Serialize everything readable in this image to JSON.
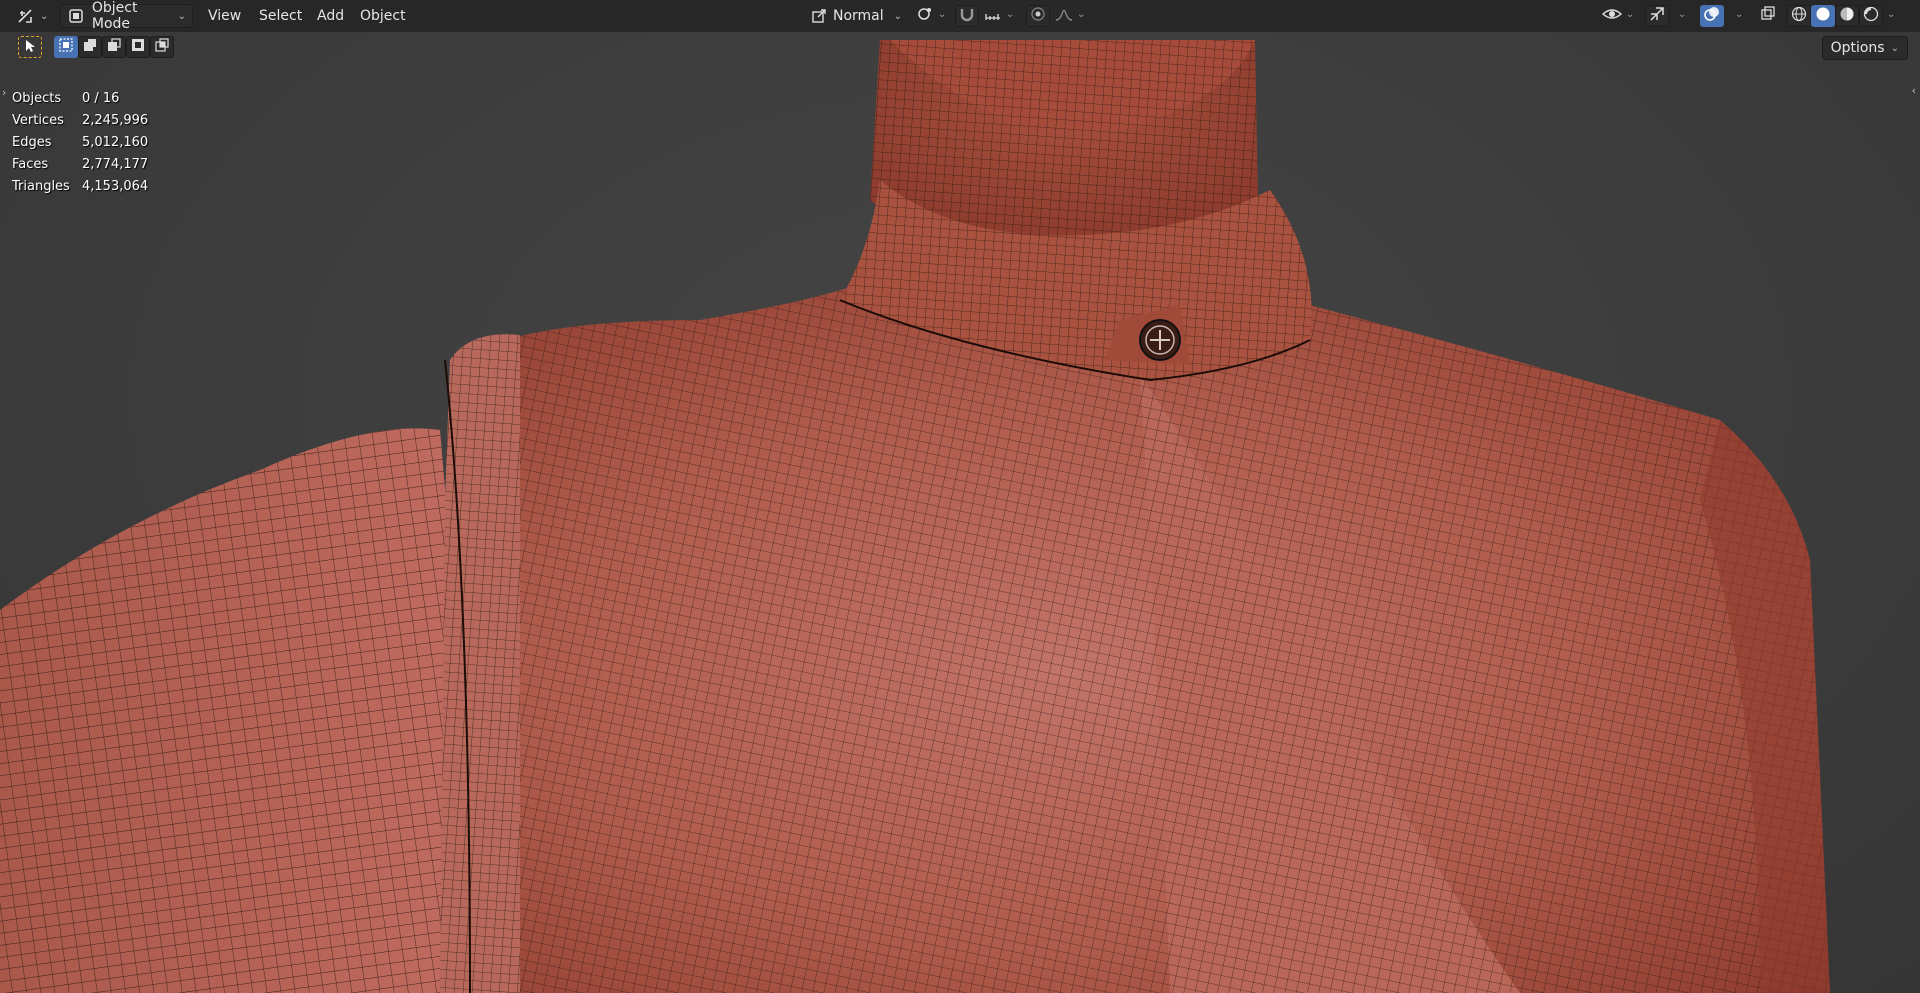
{
  "header": {
    "mode_label": "Object Mode",
    "menus": [
      "View",
      "Select",
      "Add",
      "Object"
    ],
    "orientation_label": "Normal",
    "options_label": "Options"
  },
  "stats": [
    {
      "label": "Objects",
      "value": "0 / 16"
    },
    {
      "label": "Vertices",
      "value": "2,245,996"
    },
    {
      "label": "Edges",
      "value": "5,012,160"
    },
    {
      "label": "Faces",
      "value": "2,774,177"
    },
    {
      "label": "Triangles",
      "value": "4,153,064"
    }
  ],
  "icons": {
    "editor_type": "transform-gizmo-icon",
    "object_mode": "object-mode-icon",
    "orientation": "transform-orientation-icon",
    "pivot": "pivot-point-icon",
    "snap": "snap-magnet-icon",
    "snap_target": "snap-increment-icon",
    "proportional": "proportional-edit-icon",
    "falloff": "falloff-curve-icon",
    "visibility": "eye-visibility-icon",
    "gizmo": "gizmo-toggle-icon",
    "overlays": "overlays-icon",
    "xray": "xray-icon",
    "wireframe": "wireframe-shading-icon",
    "solid": "solid-shading-icon",
    "material": "material-preview-icon",
    "rendered": "rendered-shading-icon",
    "select_box": "select-box-icon"
  },
  "colors": {
    "header": "#262626",
    "viewport": "#3d3d3d",
    "mesh": "#b65a4a",
    "active": "#4772b3",
    "select_tool": "#e5a52a"
  }
}
